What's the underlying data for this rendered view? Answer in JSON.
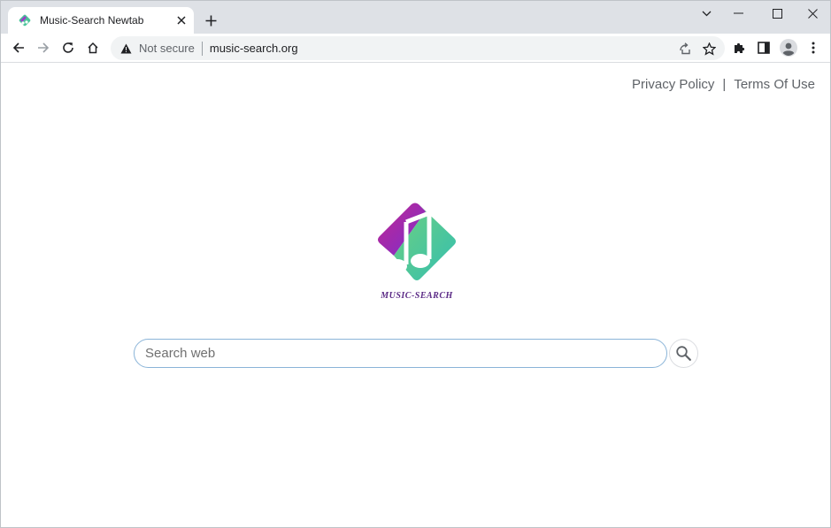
{
  "browser": {
    "tab": {
      "title": "Music-Search Newtab",
      "favicon": "music-search-favicon"
    },
    "address_bar": {
      "security_label": "Not secure",
      "url": "music-search.org"
    },
    "icons": {
      "back": "arrow-left-icon",
      "forward": "arrow-right-icon",
      "reload": "reload-icon",
      "home": "home-icon",
      "share": "share-icon",
      "bookmark": "star-icon",
      "extensions": "puzzle-icon",
      "side_panel": "side-panel-icon",
      "profile": "avatar-icon",
      "menu": "kebab-menu-icon"
    }
  },
  "page": {
    "links": {
      "privacy": "Privacy Policy",
      "separator": "|",
      "terms": "Terms Of Use"
    },
    "logo": {
      "text": "MUSIC-SEARCH",
      "colors": {
        "purple": "#8a2be2",
        "magenta": "#c2268f",
        "teal": "#3cc3a0",
        "green": "#5ec98a",
        "text": "#5b2a86"
      }
    },
    "search": {
      "placeholder": "Search web",
      "value": ""
    }
  }
}
